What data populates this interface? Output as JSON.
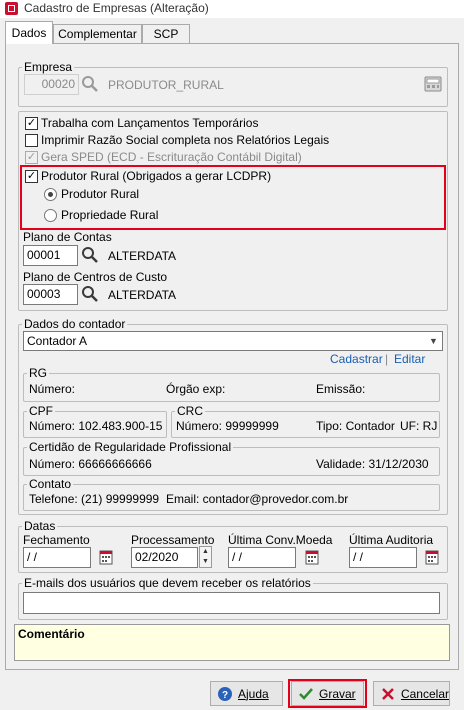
{
  "window": {
    "title": "Cadastro de Empresas (Alteração)"
  },
  "tabs": [
    {
      "label": "Dados"
    },
    {
      "label": "Complementar"
    },
    {
      "label": "SCP"
    }
  ],
  "empresa": {
    "legend": "Empresa",
    "code": "00020",
    "name": "PRODUTOR_RURAL"
  },
  "options": {
    "trabalha": {
      "label": "Trabalha com Lançamentos Temporários",
      "checked": true
    },
    "imprimir": {
      "label": "Imprimir Razão Social completa nos Relatórios Legais",
      "checked": false
    },
    "gera_sped": {
      "label": "Gera SPED (ECD - Escrituração Contábil Digital)",
      "checked": true,
      "disabled": true
    },
    "produtor_rural": {
      "label": "Produtor Rural  (Obrigados a gerar LCDPR)",
      "checked": true
    },
    "radio_produtor": {
      "label": "Produtor Rural",
      "selected": true
    },
    "radio_propriedade": {
      "label": "Propriedade Rural",
      "selected": false
    }
  },
  "plano_contas": {
    "label": "Plano de Contas",
    "code": "00001",
    "name": "ALTERDATA"
  },
  "plano_centros": {
    "label": "Plano de Centros de Custo",
    "code": "00003",
    "name": "ALTERDATA"
  },
  "contador": {
    "legend": "Dados do contador",
    "selected": "Contador A",
    "cadastrar": "Cadastrar",
    "separator": "|",
    "editar": "Editar",
    "rg_legend": "RG",
    "numero_label": "Número:",
    "orgao_label": "Órgão exp:",
    "emissao_label": "Emissão:",
    "cpf_legend": "CPF",
    "cpf_value": "Número: 102.483.900-15",
    "crc_legend": "CRC",
    "crc_value": "Número: 99999999",
    "tipo": "Tipo: Contador",
    "uf": "UF: RJ",
    "certidao_legend": "Certidão de Regularidade Profissional",
    "certidao_numero": "Número: 66666666666",
    "validade": "Validade: 31/12/2030",
    "contato_legend": "Contato",
    "telefone": "Telefone: (21) 99999999",
    "email": "Email: contador@provedor.com.br"
  },
  "datas": {
    "legend": "Datas",
    "fechamento_label": "Fechamento",
    "fechamento_value": " / /",
    "processamento_label": "Processamento",
    "processamento_value": "02/2020",
    "conv_label": "Última Conv.Moeda",
    "conv_value": " / /",
    "auditoria_label": "Última Auditoria",
    "auditoria_value": " / /"
  },
  "emails": {
    "legend": "E-mails dos usuários que devem receber os relatórios",
    "value": ""
  },
  "comentario": {
    "label": "Comentário"
  },
  "buttons": {
    "ajuda": "Ajuda",
    "gravar": "Gravar",
    "cancelar": "Cancelar"
  },
  "colors": {
    "highlight": "#e2001a",
    "link": "#1a5fb4",
    "comment_bg": "#ffffe1"
  },
  "icons": [
    "app-icon",
    "search-icon",
    "calculator-icon",
    "calendar-icon",
    "help-icon",
    "check-icon",
    "cancel-icon"
  ]
}
